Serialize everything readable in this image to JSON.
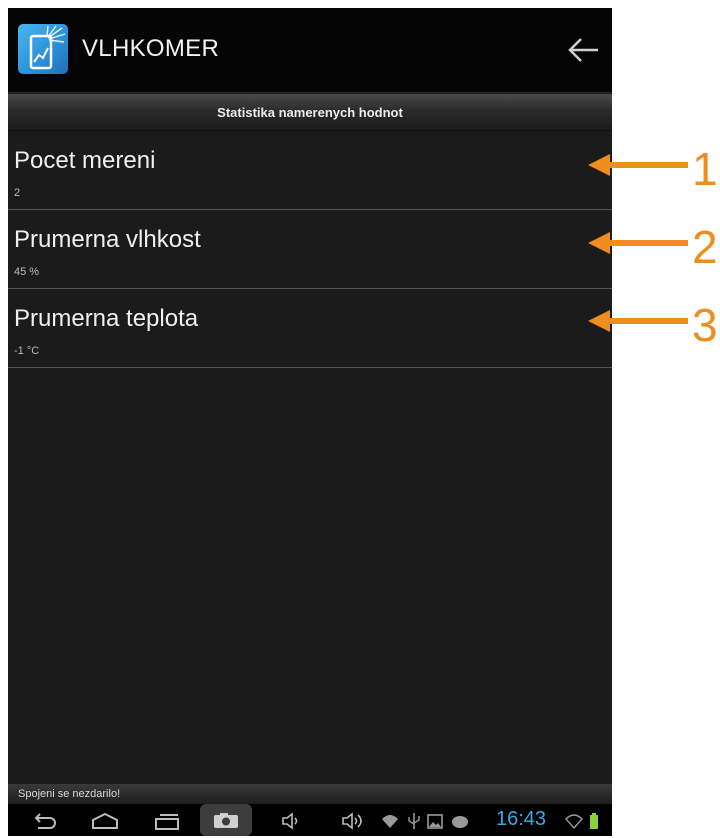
{
  "app": {
    "title": "VLHKOMER"
  },
  "section": {
    "header": "Statistika namerenych hodnot"
  },
  "stats": [
    {
      "label": "Pocet mereni",
      "value": "2"
    },
    {
      "label": "Prumerna vlhkost",
      "value": "45 %"
    },
    {
      "label": "Prumerna teplota",
      "value": "-1 °C"
    }
  ],
  "annotations": [
    "1",
    "2",
    "3"
  ],
  "toast": {
    "message": "Spojeni se nezdarilo!"
  },
  "system_bar": {
    "clock": "16:43",
    "icons": [
      "back-icon",
      "home-icon",
      "recent-apps-icon",
      "screenshot-icon",
      "volume-down-icon",
      "volume-up-icon",
      "wifi-icon",
      "usb-icon",
      "gallery-icon",
      "android-icon",
      "wifi-signal-icon",
      "battery-icon"
    ]
  },
  "colors": {
    "accent_orange": "#f08d1f",
    "clock_blue": "#39a9e6",
    "background": "#1b1b1b"
  }
}
